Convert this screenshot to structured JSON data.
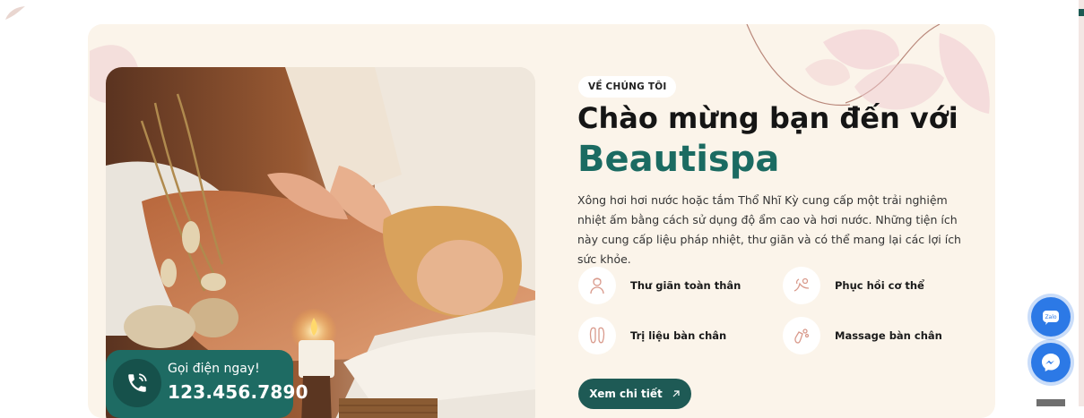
{
  "about": {
    "badge": "VỀ CHÚNG TÔI",
    "title_line1": "Chào mừng bạn đến với",
    "title_line2": "Beautispa",
    "description": "Xông hơi hơi nước hoặc tắm Thổ Nhĩ Kỳ cung cấp một trải nghiệm nhiệt ấm bằng cách sử dụng độ ẩm cao và hơi nước. Những tiện ích này cung cấp liệu pháp nhiệt, thư giãn và có thể mang lại các lợi ích sức khỏe.",
    "features": [
      {
        "label": "Thư giãn toàn thân",
        "icon": "relax-body-icon"
      },
      {
        "label": "Phục hồi cơ thể",
        "icon": "body-recovery-icon"
      },
      {
        "label": "Trị liệu bàn chân",
        "icon": "foot-therapy-icon"
      },
      {
        "label": "Massage bàn chân",
        "icon": "foot-massage-icon"
      }
    ],
    "cta_label": "Xem chi tiết",
    "cta_icon": "arrow-up-right-icon"
  },
  "call": {
    "label": "Gọi điện ngay!",
    "phone": "123.456.7890",
    "icon": "phone-icon"
  },
  "floating": {
    "contact_icon": "zalo-icon",
    "messenger_icon": "messenger-icon"
  },
  "colors": {
    "primary": "#1b6b62",
    "section_bg": "#fbf4ea",
    "float_blue": "#2c79e6"
  }
}
